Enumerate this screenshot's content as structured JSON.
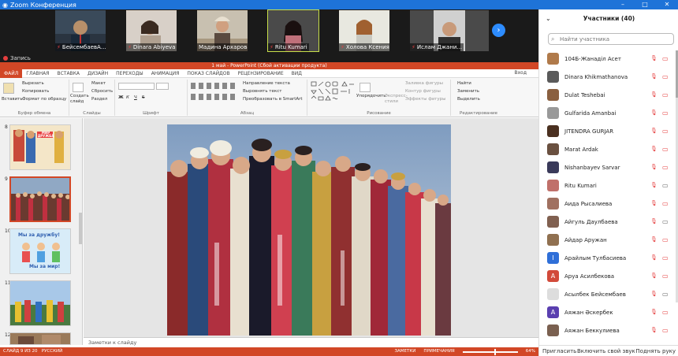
{
  "window": {
    "title": "Zoom Конференция",
    "icon": "zoom-icon",
    "controls": [
      "–",
      "□",
      "✕"
    ]
  },
  "video_strip": {
    "tiles": [
      {
        "name": "БейсембаевА...",
        "speaking": false
      },
      {
        "name": "Dinara Abiyeva",
        "speaking": false
      },
      {
        "name": "Мадина Архарова",
        "speaking": true
      },
      {
        "name": "Ritu Kumari",
        "speaking": false
      },
      {
        "name": "Холова Ксения",
        "speaking": false
      },
      {
        "name": "Ислам Джани...",
        "speaking": false
      }
    ],
    "next_label": "›"
  },
  "recording": {
    "label": "Запись"
  },
  "powerpoint": {
    "title": "1 май - PowerPoint (Сбой активации продукта)",
    "tabs": [
      "ФАЙЛ",
      "ГЛАВНАЯ",
      "ВСТАВКА",
      "ДИЗАЙН",
      "ПЕРЕХОДЫ",
      "АНИМАЦИЯ",
      "ПОКАЗ СЛАЙДОВ",
      "РЕЦЕНЗИРОВАНИЕ",
      "ВИД"
    ],
    "active_tab": "ФАЙЛ",
    "view_label": "Вход",
    "ribbon": {
      "clipboard": {
        "paste": "Вставить",
        "cut": "Вырезать",
        "copy": "Копировать",
        "format": "Формат по образцу",
        "group": "Буфер обмена"
      },
      "slides": {
        "new": "Создать слайд",
        "layout": "Макет",
        "reset": "Сбросить",
        "section": "Раздел",
        "group": "Слайды"
      },
      "font": {
        "group": "Шрифт",
        "bold": "Ж",
        "italic": "К",
        "underline": "Ч",
        "strike": "S"
      },
      "paragraph": {
        "group": "Абзац",
        "dir": "Направление текста",
        "align": "Выровнять текст",
        "smartart": "Преобразовать в SmartArt"
      },
      "drawing": {
        "arrange": "Упорядочить",
        "styles": "Экспресс-стили",
        "fill": "Заливка фигуры",
        "outline": "Контур фигуры",
        "effects": "Эффекты фигуры",
        "group": "Рисование"
      },
      "editing": {
        "find": "Найти",
        "replace": "Заменить",
        "select": "Выделить",
        "group": "Редактирование"
      }
    },
    "slide_panel": [
      {
        "n": "8"
      },
      {
        "n": "9",
        "selected": true
      },
      {
        "n": "10",
        "t1": "Мы за дружбу!",
        "t2": "Мы за мир!"
      },
      {
        "n": "11"
      },
      {
        "n": "12"
      }
    ],
    "slide8_caption": "МИР ДРУЖБА",
    "notes": "Заметки к слайду",
    "status": {
      "left": "СЛАЙД 9 ИЗ 20",
      "lang": "РУССКИЙ",
      "notes": "ЗАМЕТКИ",
      "comments": "ПРИМЕЧАНИЯ",
      "zoom": "64%"
    }
  },
  "participants": {
    "title": "Участники (40)",
    "search_placeholder": "Найти участника",
    "list": [
      {
        "name": "104Б-Жанаділ Асет",
        "avatar": "photo",
        "color": "#b07a4a",
        "cam": "off"
      },
      {
        "name": "Dinara Khikmathanova",
        "avatar": "photo",
        "color": "#5a5a5a",
        "cam": "off"
      },
      {
        "name": "Dulat Teshebai",
        "avatar": "photo",
        "color": "#8a6040",
        "cam": "off"
      },
      {
        "name": "Gulfarida Amanbai",
        "avatar": "photo",
        "color": "#999999",
        "cam": "off"
      },
      {
        "name": "JITENDRA GURJAR",
        "avatar": "photo",
        "color": "#4a3020",
        "cam": "off"
      },
      {
        "name": "Marat Ardak",
        "avatar": "photo",
        "color": "#6a5040",
        "cam": "off"
      },
      {
        "name": "Nishanbayev Sarvar",
        "avatar": "photo",
        "color": "#3a3a5a",
        "cam": "off"
      },
      {
        "name": "Ritu Kumari",
        "avatar": "photo",
        "color": "#c0706a",
        "cam": "on"
      },
      {
        "name": "Аида Рысалиева",
        "avatar": "photo",
        "color": "#a07060",
        "cam": "off"
      },
      {
        "name": "Айгуль Даулбаева",
        "avatar": "photo",
        "color": "#806050",
        "cam": "on"
      },
      {
        "name": "Айдар Аружан",
        "avatar": "photo",
        "color": "#907050",
        "cam": "off"
      },
      {
        "name": "Арайлым Тулбасиева",
        "avatar": "I",
        "color": "#2f6fd8",
        "cam": "off"
      },
      {
        "name": "Аруа Асилбекова",
        "avatar": "A",
        "color": "#d24a3a",
        "cam": "off"
      },
      {
        "name": "Асылбек Бейсембаев",
        "avatar": "photo",
        "color": "#dddddd",
        "cam": "on"
      },
      {
        "name": "Аяжан Әскербек",
        "avatar": "A",
        "color": "#5a3fb0",
        "cam": "off"
      },
      {
        "name": "Аяжан Беккулиева",
        "avatar": "photo",
        "color": "#7a6050",
        "cam": "off"
      }
    ],
    "footer": {
      "invite": "Пригласить",
      "unmute": "Включить свой звук",
      "raise": "Поднять руку"
    }
  }
}
